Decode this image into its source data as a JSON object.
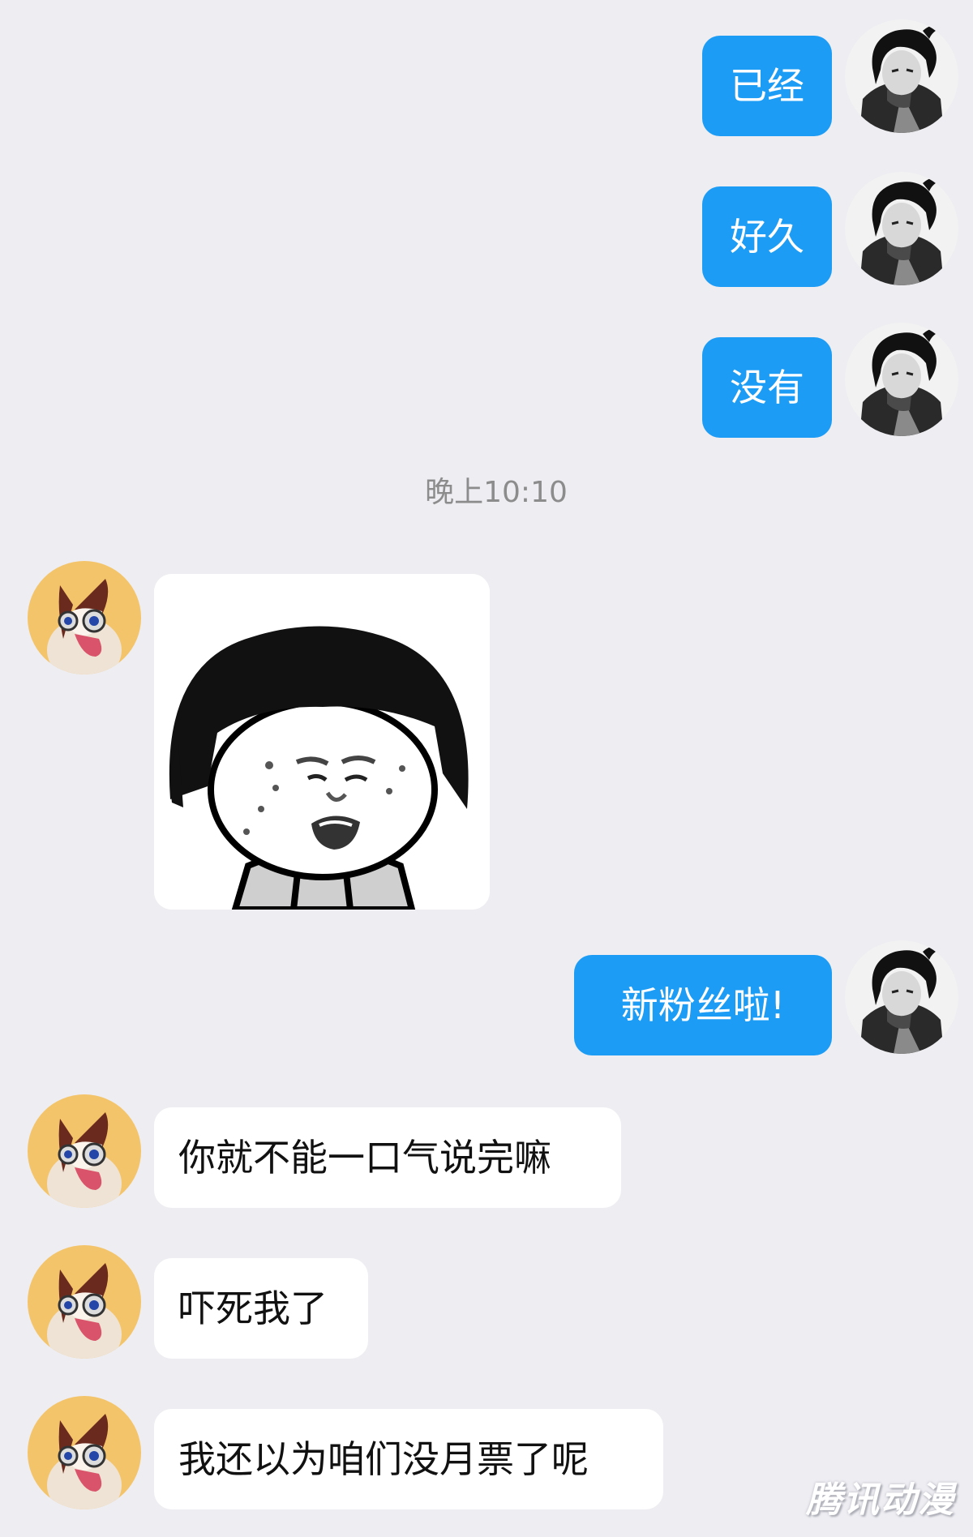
{
  "chat": {
    "messages": [
      {
        "side": "out",
        "text": "已经"
      },
      {
        "side": "out",
        "text": "好久"
      },
      {
        "side": "out",
        "text": "没有"
      },
      {
        "side": "in",
        "type": "sticker",
        "icon": "mushroom-head-meme-sticker"
      },
      {
        "side": "out",
        "text": "新粉丝啦!"
      },
      {
        "side": "in",
        "text": "你就不能一口气说完嘛"
      },
      {
        "side": "in",
        "text": "吓死我了"
      },
      {
        "side": "in",
        "text": "我还以为咱们没月票了呢"
      }
    ],
    "timestamp": "晚上10:10"
  },
  "avatars": {
    "self": "ink-warrior-avatar",
    "other": "cartoon-bird-avatar"
  },
  "colors": {
    "background": "#ededf2",
    "outgoing_bubble": "#1c9cf5",
    "incoming_bubble": "#ffffff"
  },
  "watermark": "腾讯动漫"
}
